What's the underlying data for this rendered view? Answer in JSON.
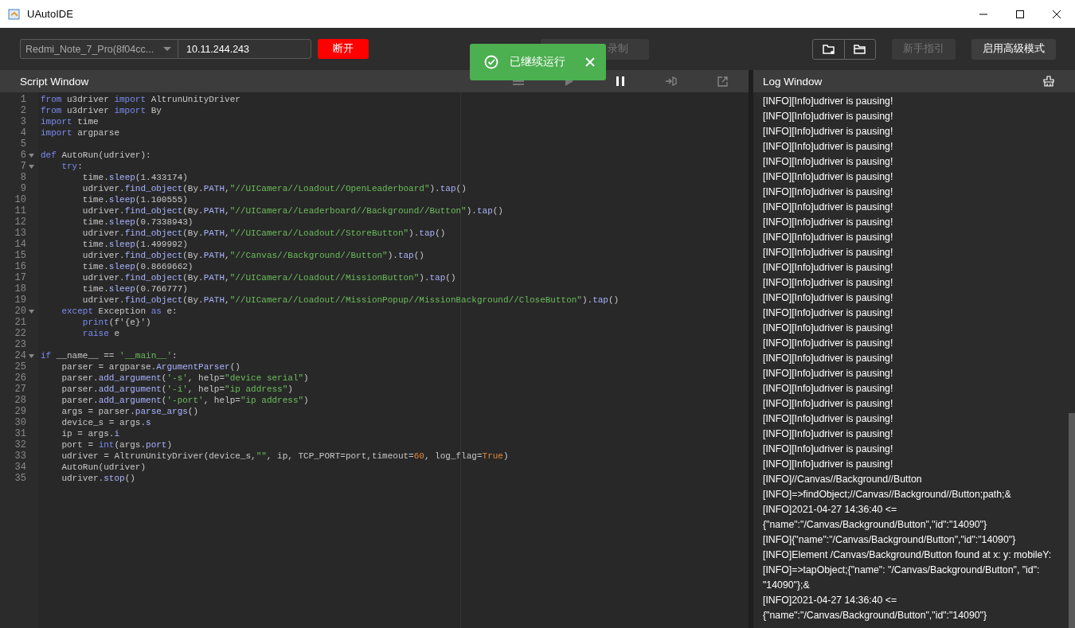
{
  "window": {
    "title": "UAutoIDE"
  },
  "toolbar": {
    "device_select": "Redmi_Note_7_Pro(8f04cc...",
    "ip_field": "10.11.244.243",
    "disconnect_button": "断开",
    "record_button": {
      "label": "录制",
      "disabled": true
    },
    "guide_button": {
      "label": "新手指引",
      "disabled": true
    },
    "advanced_button": {
      "label": "启用高级模式",
      "disabled": false
    }
  },
  "toast": {
    "message": "已继续运行"
  },
  "script_window": {
    "title": "Script Window",
    "lines": [
      {
        "number": "1",
        "tokens": [
          {
            "kind": "kw",
            "text": "from"
          },
          {
            "kind": "p",
            "text": " u3driver "
          },
          {
            "kind": "kw",
            "text": "import"
          },
          {
            "kind": "p",
            "text": " AltrunUnityDriver"
          }
        ]
      },
      {
        "number": "2",
        "tokens": [
          {
            "kind": "kw",
            "text": "from"
          },
          {
            "kind": "p",
            "text": " u3driver "
          },
          {
            "kind": "kw",
            "text": "import"
          },
          {
            "kind": "p",
            "text": " By"
          }
        ]
      },
      {
        "number": "3",
        "tokens": [
          {
            "kind": "kw",
            "text": "import"
          },
          {
            "kind": "p",
            "text": " time"
          }
        ]
      },
      {
        "number": "4",
        "tokens": [
          {
            "kind": "kw",
            "text": "import"
          },
          {
            "kind": "p",
            "text": " argparse"
          }
        ]
      },
      {
        "number": "5"
      },
      {
        "number": "6",
        "expanded": true,
        "tokens": [
          {
            "kind": "kw",
            "text": "def"
          },
          {
            "kind": "p",
            "text": " AutoRun(udriver):"
          }
        ]
      },
      {
        "number": "7",
        "expanded": true,
        "tokens": [
          {
            "kind": "kw",
            "text": "    try"
          },
          {
            "kind": "p",
            "text": ":"
          }
        ]
      },
      {
        "number": "8",
        "tokens": [
          {
            "kind": "p",
            "text": "        time."
          },
          {
            "kind": "fn",
            "text": "sleep"
          },
          {
            "kind": "p",
            "text": "(1.433174)"
          }
        ]
      },
      {
        "number": "9",
        "tokens": [
          {
            "kind": "p",
            "text": "        udriver."
          },
          {
            "kind": "fn",
            "text": "find_object"
          },
          {
            "kind": "p",
            "text": "(By."
          },
          {
            "kind": "fn",
            "text": "PATH"
          },
          {
            "kind": "p",
            "text": ","
          },
          {
            "kind": "s",
            "text": "\"//UICamera//Loadout//OpenLeaderboard\""
          },
          {
            "kind": "p",
            "text": ")."
          },
          {
            "kind": "fn",
            "text": "tap"
          },
          {
            "kind": "p",
            "text": "()"
          }
        ]
      },
      {
        "number": "10",
        "tokens": [
          {
            "kind": "p",
            "text": "        time."
          },
          {
            "kind": "fn",
            "text": "sleep"
          },
          {
            "kind": "p",
            "text": "(1.100555)"
          }
        ]
      },
      {
        "number": "11",
        "tokens": [
          {
            "kind": "p",
            "text": "        udriver."
          },
          {
            "kind": "fn",
            "text": "find_object"
          },
          {
            "kind": "p",
            "text": "(By."
          },
          {
            "kind": "fn",
            "text": "PATH"
          },
          {
            "kind": "p",
            "text": ","
          },
          {
            "kind": "s",
            "text": "\"//UICamera//Leaderboard//Background//Button\""
          },
          {
            "kind": "p",
            "text": ")."
          },
          {
            "kind": "fn",
            "text": "tap"
          },
          {
            "kind": "p",
            "text": "()"
          }
        ]
      },
      {
        "number": "12",
        "tokens": [
          {
            "kind": "p",
            "text": "        time."
          },
          {
            "kind": "fn",
            "text": "sleep"
          },
          {
            "kind": "p",
            "text": "(0.7338943)"
          }
        ]
      },
      {
        "number": "13",
        "tokens": [
          {
            "kind": "p",
            "text": "        udriver."
          },
          {
            "kind": "fn",
            "text": "find_object"
          },
          {
            "kind": "p",
            "text": "(By."
          },
          {
            "kind": "fn",
            "text": "PATH"
          },
          {
            "kind": "p",
            "text": ","
          },
          {
            "kind": "s",
            "text": "\"//UICamera//Loadout//StoreButton\""
          },
          {
            "kind": "p",
            "text": ")."
          },
          {
            "kind": "fn",
            "text": "tap"
          },
          {
            "kind": "p",
            "text": "()"
          }
        ]
      },
      {
        "number": "14",
        "tokens": [
          {
            "kind": "p",
            "text": "        time."
          },
          {
            "kind": "fn",
            "text": "sleep"
          },
          {
            "kind": "p",
            "text": "(1.499992)"
          }
        ]
      },
      {
        "number": "15",
        "tokens": [
          {
            "kind": "p",
            "text": "        udriver."
          },
          {
            "kind": "fn",
            "text": "find_object"
          },
          {
            "kind": "p",
            "text": "(By."
          },
          {
            "kind": "fn",
            "text": "PATH"
          },
          {
            "kind": "p",
            "text": ","
          },
          {
            "kind": "s",
            "text": "\"//Canvas//Background//Button\""
          },
          {
            "kind": "p",
            "text": ")."
          },
          {
            "kind": "fn",
            "text": "tap"
          },
          {
            "kind": "p",
            "text": "()"
          }
        ]
      },
      {
        "number": "16",
        "tokens": [
          {
            "kind": "p",
            "text": "        time."
          },
          {
            "kind": "fn",
            "text": "sleep"
          },
          {
            "kind": "p",
            "text": "(0.8669662)"
          }
        ]
      },
      {
        "number": "17",
        "tokens": [
          {
            "kind": "p",
            "text": "        udriver."
          },
          {
            "kind": "fn",
            "text": "find_object"
          },
          {
            "kind": "p",
            "text": "(By."
          },
          {
            "kind": "fn",
            "text": "PATH"
          },
          {
            "kind": "p",
            "text": ","
          },
          {
            "kind": "s",
            "text": "\"//UICamera//Loadout//MissionButton\""
          },
          {
            "kind": "p",
            "text": ")."
          },
          {
            "kind": "fn",
            "text": "tap"
          },
          {
            "kind": "p",
            "text": "()"
          }
        ]
      },
      {
        "number": "18",
        "tokens": [
          {
            "kind": "p",
            "text": "        time."
          },
          {
            "kind": "fn",
            "text": "sleep"
          },
          {
            "kind": "p",
            "text": "(0.766777)"
          }
        ]
      },
      {
        "number": "19",
        "tokens": [
          {
            "kind": "p",
            "text": "        udriver."
          },
          {
            "kind": "fn",
            "text": "find_object"
          },
          {
            "kind": "p",
            "text": "(By."
          },
          {
            "kind": "fn",
            "text": "PATH"
          },
          {
            "kind": "p",
            "text": ","
          },
          {
            "kind": "s",
            "text": "\"//UICamera//Loadout//MissionPopup//MissionBackground//CloseButton\""
          },
          {
            "kind": "p",
            "text": ")."
          },
          {
            "kind": "fn",
            "text": "tap"
          },
          {
            "kind": "p",
            "text": "()"
          }
        ]
      },
      {
        "number": "20",
        "expanded": true,
        "tokens": [
          {
            "kind": "kw",
            "text": "    except"
          },
          {
            "kind": "p",
            "text": " Exception "
          },
          {
            "kind": "kw",
            "text": "as"
          },
          {
            "kind": "p",
            "text": " e:"
          }
        ]
      },
      {
        "number": "21",
        "tokens": [
          {
            "kind": "kw",
            "text": "        print"
          },
          {
            "kind": "p",
            "text": "(f'{e}')"
          }
        ]
      },
      {
        "number": "22",
        "tokens": [
          {
            "kind": "kw",
            "text": "        raise"
          },
          {
            "kind": "p",
            "text": " e"
          }
        ]
      },
      {
        "number": "23"
      },
      {
        "number": "24",
        "expanded": true,
        "tokens": [
          {
            "kind": "kw",
            "text": "if"
          },
          {
            "kind": "p",
            "text": " __name__ == "
          },
          {
            "kind": "s",
            "text": "'__main__'"
          },
          {
            "kind": "p",
            "text": ":"
          }
        ]
      },
      {
        "number": "25",
        "tokens": [
          {
            "kind": "p",
            "text": "    parser = argparse."
          },
          {
            "kind": "fn",
            "text": "ArgumentParser"
          },
          {
            "kind": "p",
            "text": "()"
          }
        ]
      },
      {
        "number": "26",
        "tokens": [
          {
            "kind": "p",
            "text": "    parser."
          },
          {
            "kind": "fn",
            "text": "add_argument"
          },
          {
            "kind": "p",
            "text": "("
          },
          {
            "kind": "s",
            "text": "'-s'"
          },
          {
            "kind": "p",
            "text": ", help="
          },
          {
            "kind": "s",
            "text": "\"device serial\""
          },
          {
            "kind": "p",
            "text": ")"
          }
        ]
      },
      {
        "number": "27",
        "tokens": [
          {
            "kind": "p",
            "text": "    parser."
          },
          {
            "kind": "fn",
            "text": "add_argument"
          },
          {
            "kind": "p",
            "text": "("
          },
          {
            "kind": "s",
            "text": "'-i'"
          },
          {
            "kind": "p",
            "text": ", help="
          },
          {
            "kind": "s",
            "text": "\"ip address\""
          },
          {
            "kind": "p",
            "text": ")"
          }
        ]
      },
      {
        "number": "28",
        "tokens": [
          {
            "kind": "p",
            "text": "    parser."
          },
          {
            "kind": "fn",
            "text": "add_argument"
          },
          {
            "kind": "p",
            "text": "("
          },
          {
            "kind": "s",
            "text": "'-port'"
          },
          {
            "kind": "p",
            "text": ", help="
          },
          {
            "kind": "s",
            "text": "\"ip address\""
          },
          {
            "kind": "p",
            "text": ")"
          }
        ]
      },
      {
        "number": "29",
        "tokens": [
          {
            "kind": "p",
            "text": "    args = parser."
          },
          {
            "kind": "fn",
            "text": "parse_args"
          },
          {
            "kind": "p",
            "text": "()"
          }
        ]
      },
      {
        "number": "30",
        "tokens": [
          {
            "kind": "p",
            "text": "    device_s = args."
          },
          {
            "kind": "fn",
            "text": "s"
          }
        ]
      },
      {
        "number": "31",
        "tokens": [
          {
            "kind": "p",
            "text": "    ip = args."
          },
          {
            "kind": "fn",
            "text": "i"
          }
        ]
      },
      {
        "number": "32",
        "tokens": [
          {
            "kind": "p",
            "text": "    port = "
          },
          {
            "kind": "kw",
            "text": "int"
          },
          {
            "kind": "p",
            "text": "(args."
          },
          {
            "kind": "fn",
            "text": "port"
          },
          {
            "kind": "p",
            "text": ")"
          }
        ]
      },
      {
        "number": "33",
        "tokens": [
          {
            "kind": "p",
            "text": "    udriver = AltrunUnityDriver(device_s,"
          },
          {
            "kind": "s",
            "text": "\"\""
          },
          {
            "kind": "p",
            "text": ", ip, TCP_PORT=port,timeout="
          },
          {
            "kind": "n",
            "text": "60"
          },
          {
            "kind": "p",
            "text": ", log_flag="
          },
          {
            "kind": "n",
            "text": "True"
          },
          {
            "kind": "p",
            "text": ")"
          }
        ]
      },
      {
        "number": "34",
        "tokens": [
          {
            "kind": "p",
            "text": "    AutoRun(udriver)"
          }
        ]
      },
      {
        "number": "35",
        "tokens": [
          {
            "kind": "p",
            "text": "    udriver."
          },
          {
            "kind": "fn",
            "text": "stop"
          },
          {
            "kind": "p",
            "text": "()"
          }
        ]
      }
    ]
  },
  "log_window": {
    "title": "Log Window",
    "lines": [
      "[INFO][Info]udriver is pausing!",
      "[INFO][Info]udriver is pausing!",
      "[INFO][Info]udriver is pausing!",
      "[INFO][Info]udriver is pausing!",
      "[INFO][Info]udriver is pausing!",
      "[INFO][Info]udriver is pausing!",
      "[INFO][Info]udriver is pausing!",
      "[INFO][Info]udriver is pausing!",
      "[INFO][Info]udriver is pausing!",
      "[INFO][Info]udriver is pausing!",
      "[INFO][Info]udriver is pausing!",
      "[INFO][Info]udriver is pausing!",
      "[INFO][Info]udriver is pausing!",
      "[INFO][Info]udriver is pausing!",
      "[INFO][Info]udriver is pausing!",
      "[INFO][Info]udriver is pausing!",
      "[INFO][Info]udriver is pausing!",
      "[INFO][Info]udriver is pausing!",
      "[INFO][Info]udriver is pausing!",
      "[INFO][Info]udriver is pausing!",
      "[INFO][Info]udriver is pausing!",
      "[INFO][Info]udriver is pausing!",
      "[INFO][Info]udriver is pausing!",
      "[INFO][Info]udriver is pausing!",
      "[INFO][Info]udriver is pausing!",
      "[INFO]//Canvas//Background//Button",
      "[INFO]=>findObject;//Canvas//Background//Button;path;&",
      "[INFO]2021-04-27 14:36:40 <= {\"name\":\"/Canvas/Background/Button\",\"id\":\"14090\"}",
      "[INFO]{\"name\":\"/Canvas/Background/Button\",\"id\":\"14090\"}",
      "[INFO]Element /Canvas/Background/Button found at x: y: mobileY:",
      "[INFO]=>tapObject;{\"name\": \"/Canvas/Background/Button\", \"id\": \"14090\"};&",
      "[INFO]2021-04-27 14:36:40 <= {\"name\":\"/Canvas/Background/Button\",\"id\":\"14090\"}"
    ]
  }
}
